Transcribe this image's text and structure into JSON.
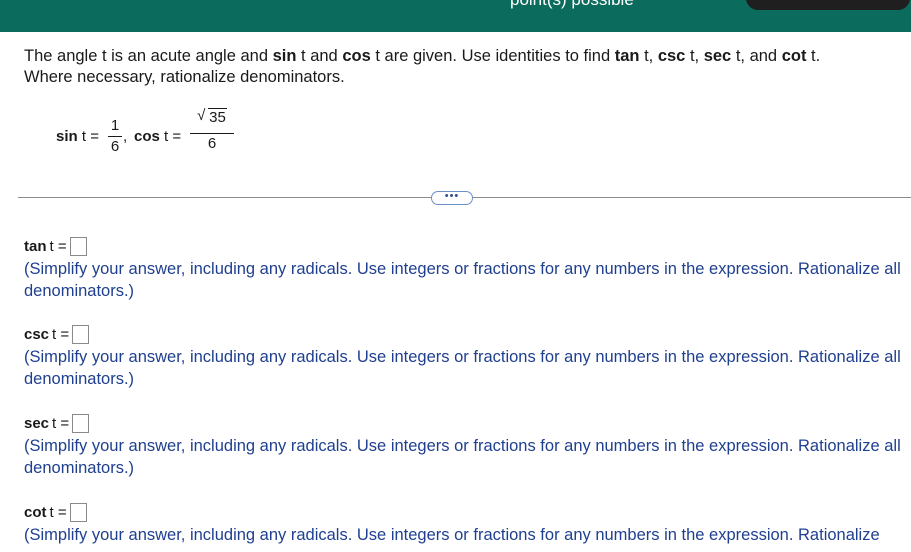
{
  "header": {
    "status_text": "point(s) possible"
  },
  "question": {
    "line1_parts": [
      "The angle t is an acute angle and ",
      "sin",
      " t and ",
      "cos",
      " t are given. Use identities to find ",
      "tan",
      " t, ",
      "csc",
      " t, ",
      "sec",
      " t, and ",
      "cot",
      " t."
    ],
    "line2": "Where necessary, rationalize denominators."
  },
  "given": {
    "sin_label": "sin",
    "sin_var": " t =",
    "sin_num": "1",
    "sin_den": "6",
    "comma": ",",
    "cos_label": "cos",
    "cos_var": " t =",
    "cos_num_sqrt": "35",
    "cos_den": "6"
  },
  "more_button": "•••",
  "answers": [
    {
      "func": "tan",
      "var": "t =",
      "hint": "(Simplify your answer, including any radicals. Use integers or fractions for any numbers in the expression. Rationalize all denominators.)"
    },
    {
      "func": "csc",
      "var": "t =",
      "hint": "(Simplify your answer, including any radicals. Use integers or fractions for any numbers in the expression. Rationalize all denominators.)"
    },
    {
      "func": "sec",
      "var": "t =",
      "hint": "(Simplify your answer, including any radicals. Use integers or fractions for any numbers in the expression. Rationalize all denominators.)"
    },
    {
      "func": "cot",
      "var": "t =",
      "hint": "(Simplify your answer, including any radicals. Use integers or fractions for any numbers in the expression. Rationalize"
    }
  ]
}
